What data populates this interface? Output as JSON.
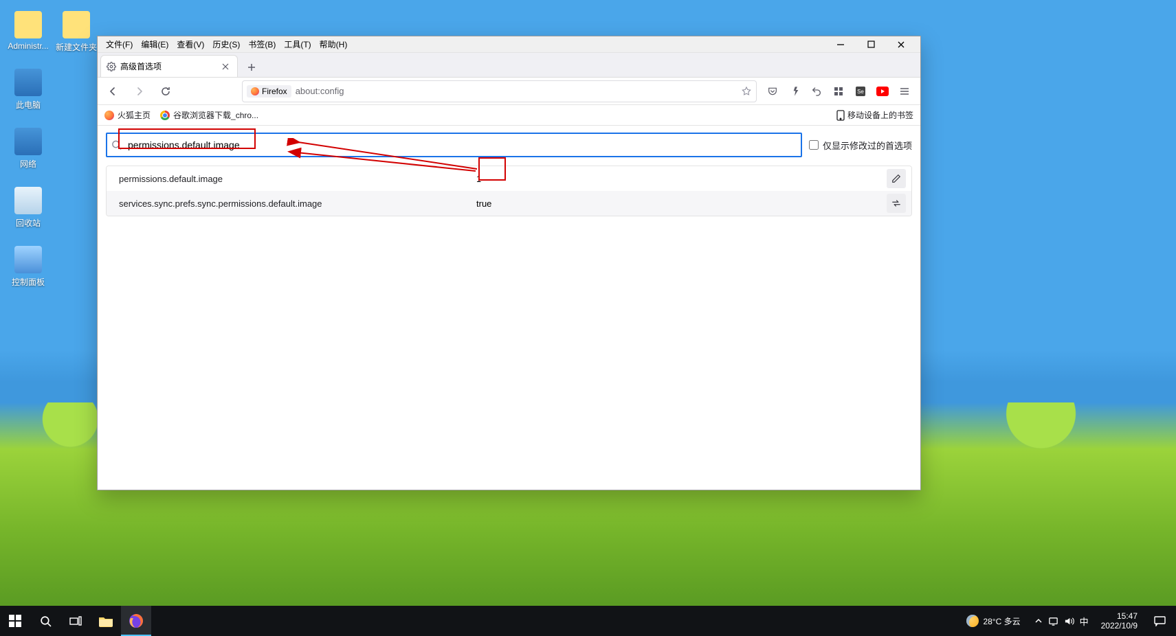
{
  "desktop_icons": {
    "administrator": "Administr...",
    "new_folder": "新建文件夹",
    "this_pc": "此电脑",
    "network": "网络",
    "recycle": "回收站",
    "control_panel": "控制面板"
  },
  "menubar": {
    "file": "文件(F)",
    "edit": "编辑(E)",
    "view": "查看(V)",
    "history": "历史(S)",
    "bookmarks": "书签(B)",
    "tools": "工具(T)",
    "help": "帮助(H)"
  },
  "tab": {
    "title": "高级首选项"
  },
  "urlbar": {
    "badge": "Firefox",
    "url": "about:config"
  },
  "bookmarks_bar": {
    "fx_home": "火狐主页",
    "chrome_dl": "谷歌浏览器下载_chro...",
    "mobile": "移动设备上的书签"
  },
  "about_config": {
    "search_value": "permissions.default.image",
    "modified_only_label": "仅显示修改过的首选项",
    "prefs": [
      {
        "name": "permissions.default.image",
        "value": "1",
        "action": "edit"
      },
      {
        "name": "services.sync.prefs.sync.permissions.default.image",
        "value": "true",
        "action": "toggle"
      }
    ]
  },
  "taskbar": {
    "weather": "28°C 多云",
    "ime": "中",
    "time": "15:47",
    "date": "2022/10/9"
  }
}
